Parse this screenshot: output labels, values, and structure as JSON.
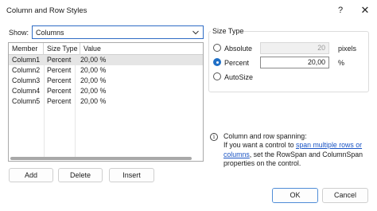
{
  "window": {
    "title": "Column and Row Styles",
    "help_glyph": "?",
    "close_glyph": "✕"
  },
  "show": {
    "label": "Show:",
    "selected": "Columns"
  },
  "grid": {
    "headers": [
      "Member",
      "Size Type",
      "Value"
    ],
    "rows": [
      {
        "member": "Column1",
        "size_type": "Percent",
        "value": "20,00 %"
      },
      {
        "member": "Column2",
        "size_type": "Percent",
        "value": "20,00 %"
      },
      {
        "member": "Column3",
        "size_type": "Percent",
        "value": "20,00 %"
      },
      {
        "member": "Column4",
        "size_type": "Percent",
        "value": "20,00 %"
      },
      {
        "member": "Column5",
        "size_type": "Percent",
        "value": "20,00 %"
      }
    ]
  },
  "list_buttons": {
    "add": "Add",
    "delete": "Delete",
    "insert": "Insert"
  },
  "size_type": {
    "group_title": "Size Type",
    "absolute_label": "Absolute",
    "absolute_value": "20",
    "absolute_unit": "pixels",
    "percent_label": "Percent",
    "percent_value": "20,00",
    "percent_unit": "%",
    "autosize_label": "AutoSize",
    "selected": "Percent"
  },
  "info": {
    "line1": "Column and row spanning:",
    "text_before_link": "If you want a control to ",
    "link_text_1": "span multiple rows or",
    "link_text_2": "columns",
    "text_after_link": ", set the RowSpan and ColumnSpan properties on the control."
  },
  "dialog_buttons": {
    "ok": "OK",
    "cancel": "Cancel"
  },
  "colors": {
    "accent": "#1f6fc6",
    "link": "#1a54c4",
    "selected_row": "#e5e5e5"
  }
}
